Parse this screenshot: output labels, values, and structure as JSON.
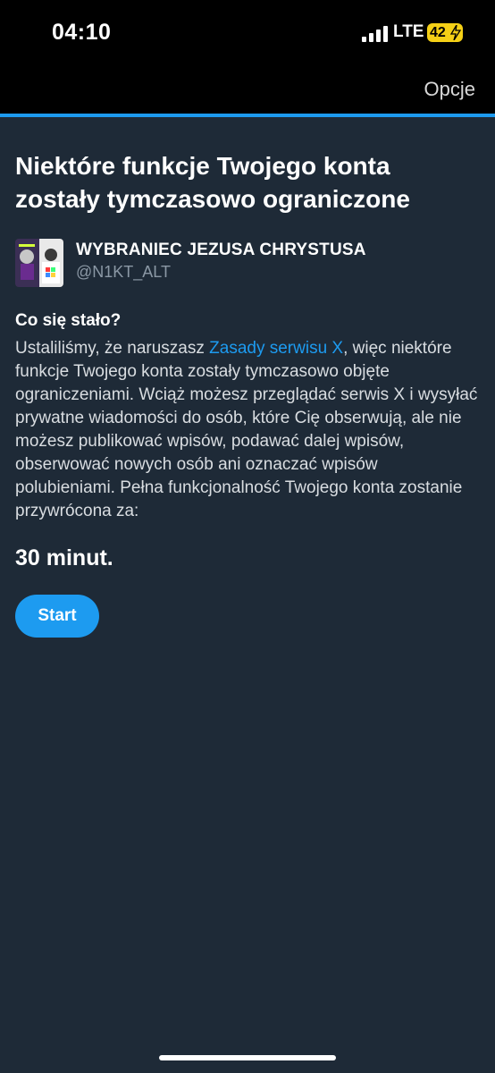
{
  "status_bar": {
    "time": "04:10",
    "network": "LTE",
    "battery_level": "42",
    "signal_icon": "cellular-signal-icon",
    "battery_icon": "battery-charging-icon"
  },
  "nav": {
    "options_label": "Opcje"
  },
  "colors": {
    "accent": "#1d9bf0",
    "background": "#1e2a37",
    "battery": "#f5d016"
  },
  "main": {
    "title": "Niektóre funkcje Twojego konta zostały tymczasowo ograniczone",
    "account": {
      "display_name": "WYBRANIEC JEZUSA CHRYSTUSA",
      "handle": "@N1KT_ALT"
    },
    "section_heading": "Co się stało?",
    "body_before_link": "Ustaliliśmy, że naruszasz ",
    "body_link": "Zasady serwisu X",
    "body_after_link": ", więc niektóre funkcje Twojego konta zostały tymczasowo objęte ograniczeniami. Wciąż możesz przeglądać serwis X i wysyłać prywatne wiadomości do osób, które Cię obserwują, ale nie możesz publikować wpisów, podawać dalej wpisów, obserwować nowych osób ani oznaczać wpisów polubieniami. Pełna funkcjonalność Twojego konta zostanie przywrócona za:",
    "countdown": "30 minut.",
    "start_label": "Start"
  }
}
